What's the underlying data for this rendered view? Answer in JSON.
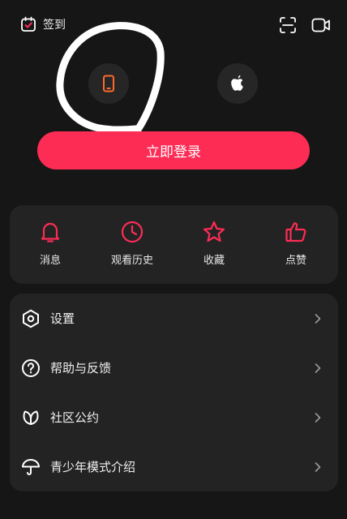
{
  "topbar": {
    "checkin_label": "签到"
  },
  "login": {
    "button_label": "立即登录"
  },
  "quick_actions": [
    {
      "label": "消息",
      "icon": "bell-icon"
    },
    {
      "label": "观看历史",
      "icon": "clock-icon"
    },
    {
      "label": "收藏",
      "icon": "star-icon"
    },
    {
      "label": "点赞",
      "icon": "thumbs-up-icon"
    }
  ],
  "menu": [
    {
      "label": "设置",
      "icon": "settings-hexagon-icon"
    },
    {
      "label": "帮助与反馈",
      "icon": "question-circle-icon"
    },
    {
      "label": "社区公约",
      "icon": "leaf-icon"
    },
    {
      "label": "青少年模式介绍",
      "icon": "umbrella-icon"
    }
  ],
  "colors": {
    "accent": "#fd2c55",
    "background": "#161616",
    "card": "#232323",
    "phone_icon": "#ff6a2b"
  }
}
